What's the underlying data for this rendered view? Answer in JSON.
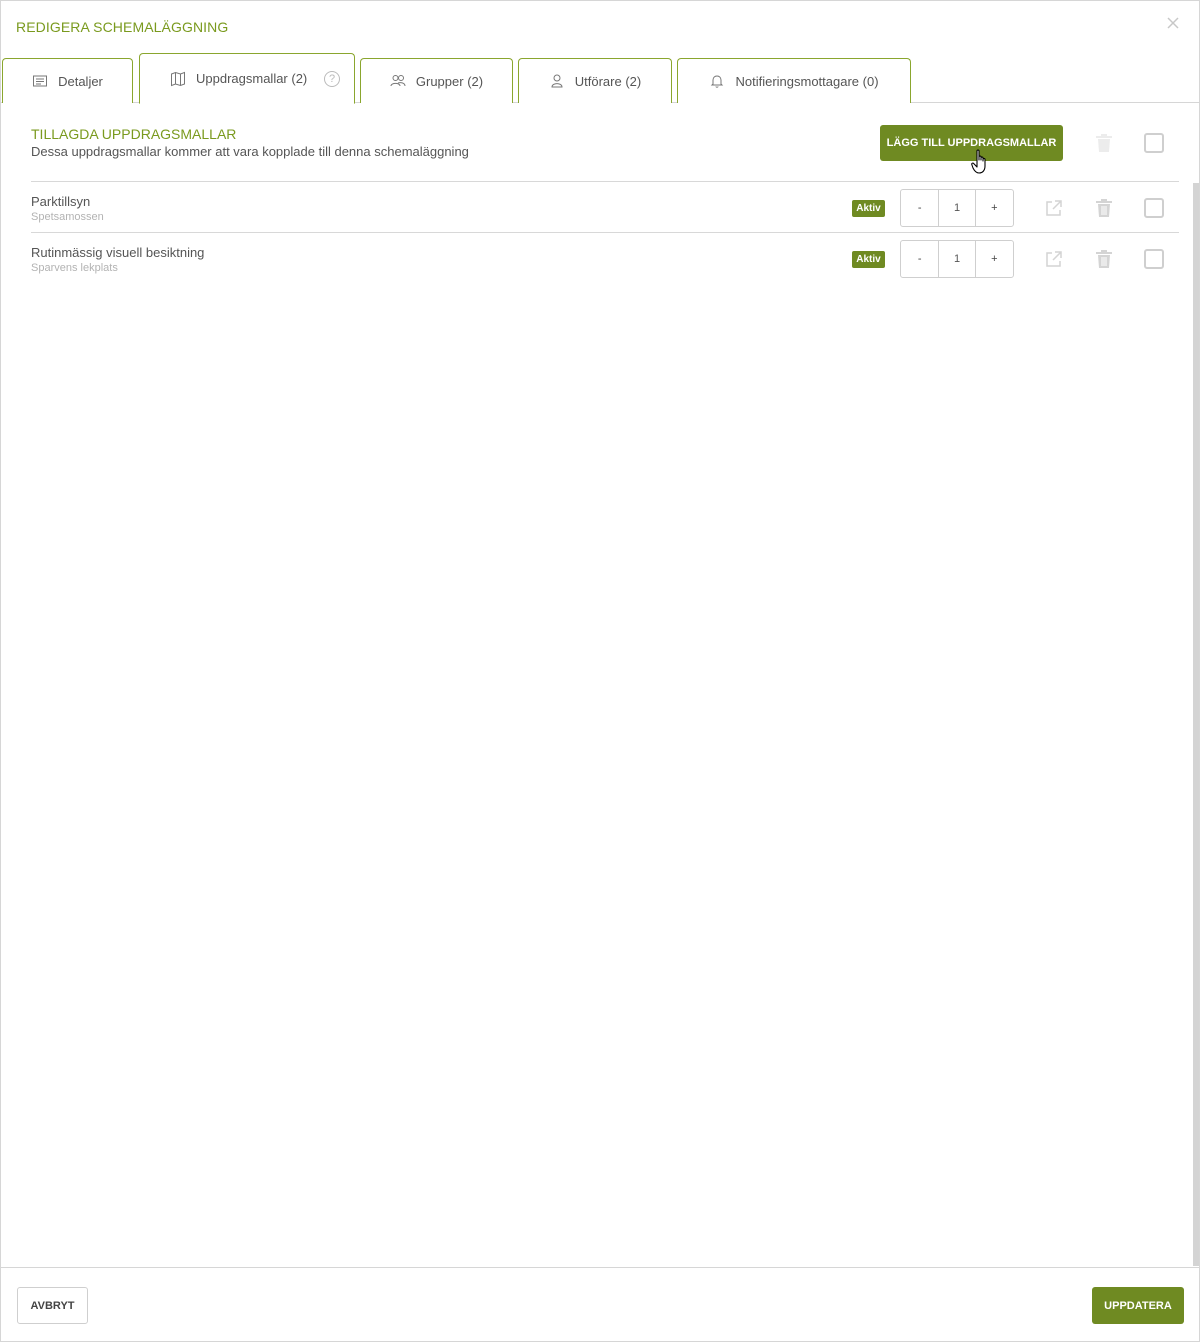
{
  "modal": {
    "title": "REDIGERA SCHEMALÄGGNING",
    "close_icon": "close-icon"
  },
  "tabs": [
    {
      "label": "Detaljer",
      "icon": "document-lines-icon"
    },
    {
      "label": "Uppdragsmallar (2)",
      "icon": "map-icon",
      "help": "?"
    },
    {
      "label": "Grupper (2)",
      "icon": "users-icon"
    },
    {
      "label": "Utförare (2)",
      "icon": "user-icon"
    },
    {
      "label": "Notifieringsmottagare (0)",
      "icon": "bell-icon"
    }
  ],
  "active_tab": "Uppdragsmallar (2)",
  "section": {
    "heading": "TILLAGDA UPPDRAGSMALLAR",
    "subheading": "Dessa uppdragsmallar kommer att vara kopplade till denna schemaläggning",
    "add_button": "LÄGG TILL UPPDRAGSMALLAR"
  },
  "items": [
    {
      "name": "Parktillsyn",
      "location": "Spetsamossen",
      "status": "Aktiv",
      "count": "1"
    },
    {
      "name": "Rutinmässig visuell besiktning",
      "location": "Sparvens lekplats",
      "status": "Aktiv",
      "count": "1"
    }
  ],
  "stepper": {
    "minus": "-",
    "plus": "+"
  },
  "footer": {
    "cancel": "AVBRYT",
    "update": "UPPDATERA"
  },
  "colors": {
    "accent": "#6f8a22",
    "heading": "#7a9a1e",
    "tab_border": "#8aa62e"
  }
}
